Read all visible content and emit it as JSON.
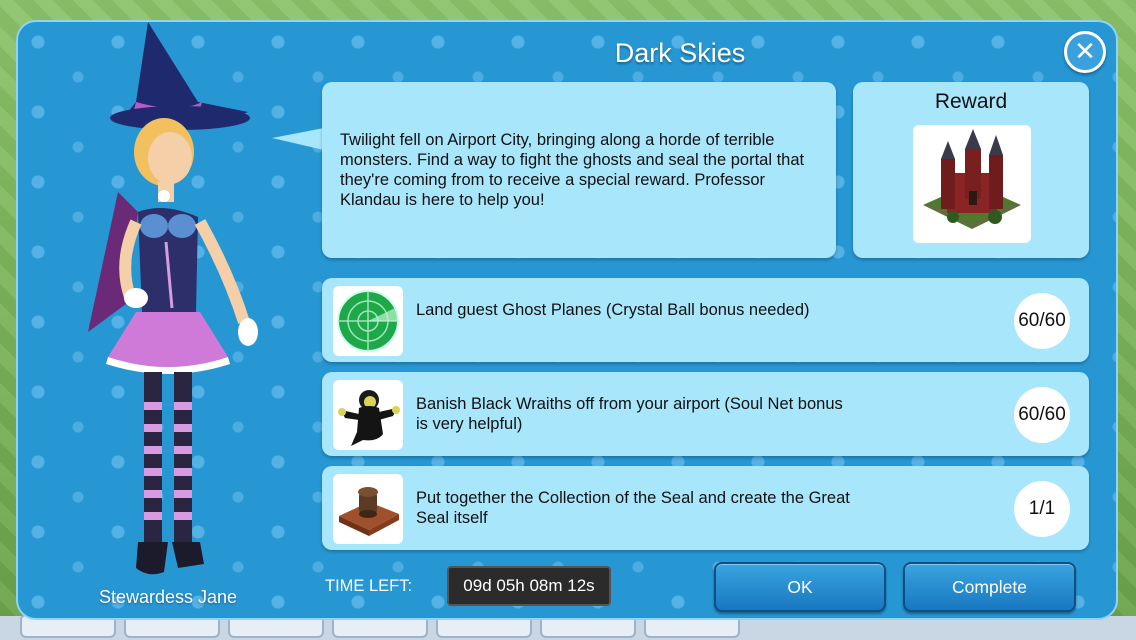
{
  "dialog": {
    "title": "Dark Skies",
    "description": "Twilight fell on Airport City, bringing along a horde of terrible monsters. Find a way to fight the ghosts and seal the portal that they're coming from to receive a special reward. Professor Klandau is here to help you!",
    "character_name": "Stewardess Jane"
  },
  "reward": {
    "title": "Reward",
    "image_icon": "haunted-castle-icon"
  },
  "tasks": [
    {
      "icon": "radar-icon",
      "text": "Land guest Ghost Planes (Crystal Ball bonus needed)",
      "progress": "60/60"
    },
    {
      "icon": "black-wraith-icon",
      "text": "Banish Black Wraiths off from your airport (Soul Net bonus is very helpful)",
      "progress": "60/60"
    },
    {
      "icon": "great-seal-icon",
      "text": "Put together the Collection of the Seal and create the Great Seal itself",
      "progress": "1/1"
    }
  ],
  "footer": {
    "time_left_label": "TIME LEFT:",
    "time_left_value": "09d 05h 08m 12s",
    "ok_label": "OK",
    "complete_label": "Complete"
  },
  "colors": {
    "panel_blue": "#2797d4",
    "card_light_blue": "#a8e6fb",
    "button_blue": "#1f8ad0"
  }
}
